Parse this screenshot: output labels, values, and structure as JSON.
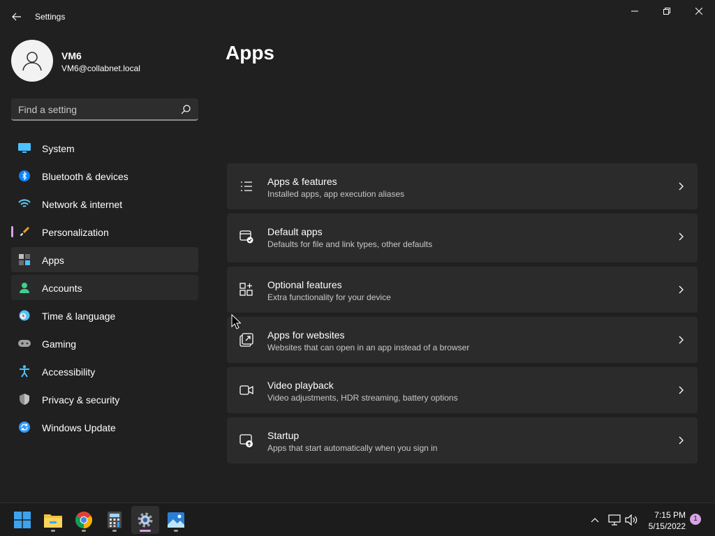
{
  "window": {
    "title": "Settings",
    "controls": {
      "minimize_icon": "minimize-icon",
      "maximize_icon": "restore-icon",
      "close_icon": "close-icon"
    }
  },
  "user": {
    "name": "VM6",
    "email": "VM6@collabnet.local",
    "avatar_icon": "user-icon"
  },
  "search": {
    "placeholder": "Find a setting",
    "icon": "search-icon"
  },
  "nav": {
    "items": [
      {
        "label": "System",
        "icon": "display-icon"
      },
      {
        "label": "Bluetooth & devices",
        "icon": "bluetooth-icon"
      },
      {
        "label": "Network & internet",
        "icon": "wifi-icon"
      },
      {
        "label": "Personalization",
        "icon": "brush-icon"
      },
      {
        "label": "Apps",
        "icon": "apps-icon",
        "selected": true
      },
      {
        "label": "Accounts",
        "icon": "person-icon"
      },
      {
        "label": "Time & language",
        "icon": "clock-globe-icon"
      },
      {
        "label": "Gaming",
        "icon": "gamepad-icon"
      },
      {
        "label": "Accessibility",
        "icon": "accessibility-icon"
      },
      {
        "label": "Privacy & security",
        "icon": "shield-icon"
      },
      {
        "label": "Windows Update",
        "icon": "update-icon"
      }
    ]
  },
  "main": {
    "title": "Apps",
    "cards": [
      {
        "title": "Apps & features",
        "subtitle": "Installed apps, app execution aliases",
        "icon": "list-icon"
      },
      {
        "title": "Default apps",
        "subtitle": "Defaults for file and link types, other defaults",
        "icon": "default-apps-icon"
      },
      {
        "title": "Optional features",
        "subtitle": "Extra functionality for your device",
        "icon": "optional-features-icon"
      },
      {
        "title": "Apps for websites",
        "subtitle": "Websites that can open in an app instead of a browser",
        "icon": "open-external-icon"
      },
      {
        "title": "Video playback",
        "subtitle": "Video adjustments, HDR streaming, battery options",
        "icon": "video-icon"
      },
      {
        "title": "Startup",
        "subtitle": "Apps that start automatically when you sign in",
        "icon": "startup-icon"
      }
    ]
  },
  "taskbar": {
    "apps": [
      {
        "name": "start-button",
        "icon": "windows-icon"
      },
      {
        "name": "file-explorer",
        "icon": "folder-icon"
      },
      {
        "name": "chrome",
        "icon": "chrome-icon"
      },
      {
        "name": "calculator",
        "icon": "calculator-icon"
      },
      {
        "name": "settings",
        "icon": "gear-icon",
        "active": true
      },
      {
        "name": "photos",
        "icon": "photos-icon"
      }
    ],
    "tray": {
      "time": "7:15 PM",
      "date": "5/15/2022",
      "notification_count": "1"
    }
  },
  "colors": {
    "background": "#202020",
    "card": "#2b2b2b",
    "accent": "#d9a2e6",
    "taskbar": "#1c1c1c"
  }
}
